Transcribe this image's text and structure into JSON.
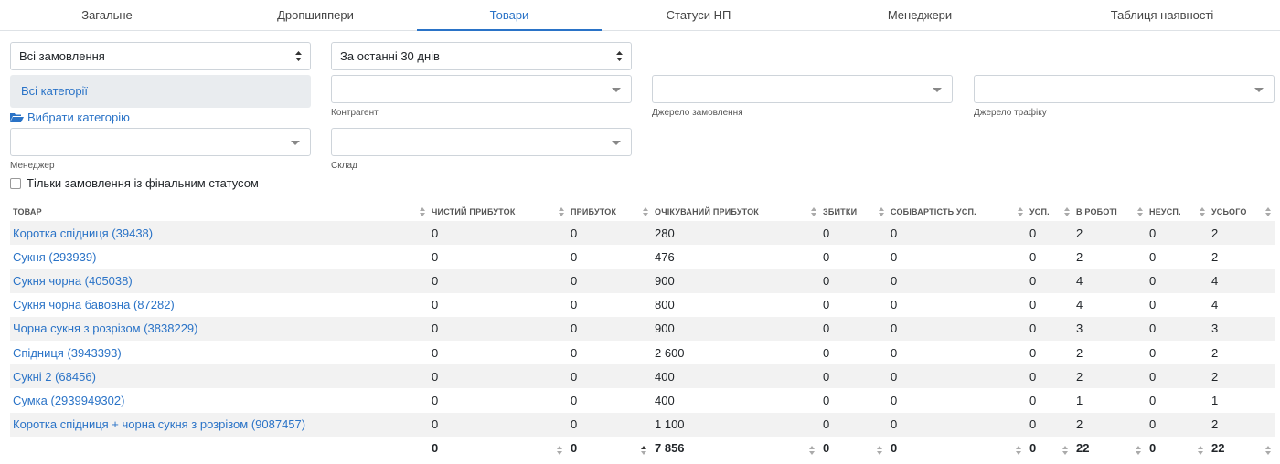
{
  "tabs": [
    {
      "label": "Загальне"
    },
    {
      "label": "Дропшиппери"
    },
    {
      "label": "Товари"
    },
    {
      "label": "Статуси НП"
    },
    {
      "label": "Менеджери"
    },
    {
      "label": "Таблиця наявності"
    }
  ],
  "active_tab": "Товари",
  "filters": {
    "orders_select": "Всі замовлення",
    "period_select": "За останні 30 днів",
    "categories": "Всі категорії",
    "choose_category": "Вибрати категорію",
    "counterparty_label": "Контрагент",
    "order_source_label": "Джерело замовлення",
    "traffic_source_label": "Джерело трафіку",
    "manager_label": "Менеджер",
    "warehouse_label": "Склад",
    "final_status_only": "Тільки замовлення із фінальним статусом"
  },
  "table": {
    "headers": [
      "Товар",
      "Чистий прибуток",
      "Прибуток",
      "Очікуваний прибуток",
      "Збитки",
      "Собівартість усп.",
      "Усп.",
      "В роботі",
      "Неусп.",
      "Усього"
    ],
    "rows": [
      [
        "Коротка спідниця (39438)",
        "0",
        "0",
        "280",
        "0",
        "0",
        "0",
        "2",
        "0",
        "2"
      ],
      [
        "Сукня (293939)",
        "0",
        "0",
        "476",
        "0",
        "0",
        "0",
        "2",
        "0",
        "2"
      ],
      [
        "Сукня чорна (405038)",
        "0",
        "0",
        "900",
        "0",
        "0",
        "0",
        "4",
        "0",
        "4"
      ],
      [
        "Сукня чорна бавовна (87282)",
        "0",
        "0",
        "800",
        "0",
        "0",
        "0",
        "4",
        "0",
        "4"
      ],
      [
        "Чорна сукня з розрізом (3838229)",
        "0",
        "0",
        "900",
        "0",
        "0",
        "0",
        "3",
        "0",
        "3"
      ],
      [
        "Спідниця (3943393)",
        "0",
        "0",
        "2 600",
        "0",
        "0",
        "0",
        "2",
        "0",
        "2"
      ],
      [
        "Сукні 2 (68456)",
        "0",
        "0",
        "400",
        "0",
        "0",
        "0",
        "2",
        "0",
        "2"
      ],
      [
        "Сумка (2939949302)",
        "0",
        "0",
        "400",
        "0",
        "0",
        "0",
        "1",
        "0",
        "1"
      ],
      [
        "Коротка спідниця + чорна сукня з розрізом (9087457)",
        "0",
        "0",
        "1 100",
        "0",
        "0",
        "0",
        "2",
        "0",
        "2"
      ]
    ],
    "totals": [
      "",
      "0",
      "0",
      "7 856",
      "0",
      "0",
      "0",
      "22",
      "0",
      "22"
    ]
  },
  "colors": {
    "accent": "#2a73c7",
    "stripe": "#f2f2f2",
    "category_bg": "#e9ecef"
  }
}
